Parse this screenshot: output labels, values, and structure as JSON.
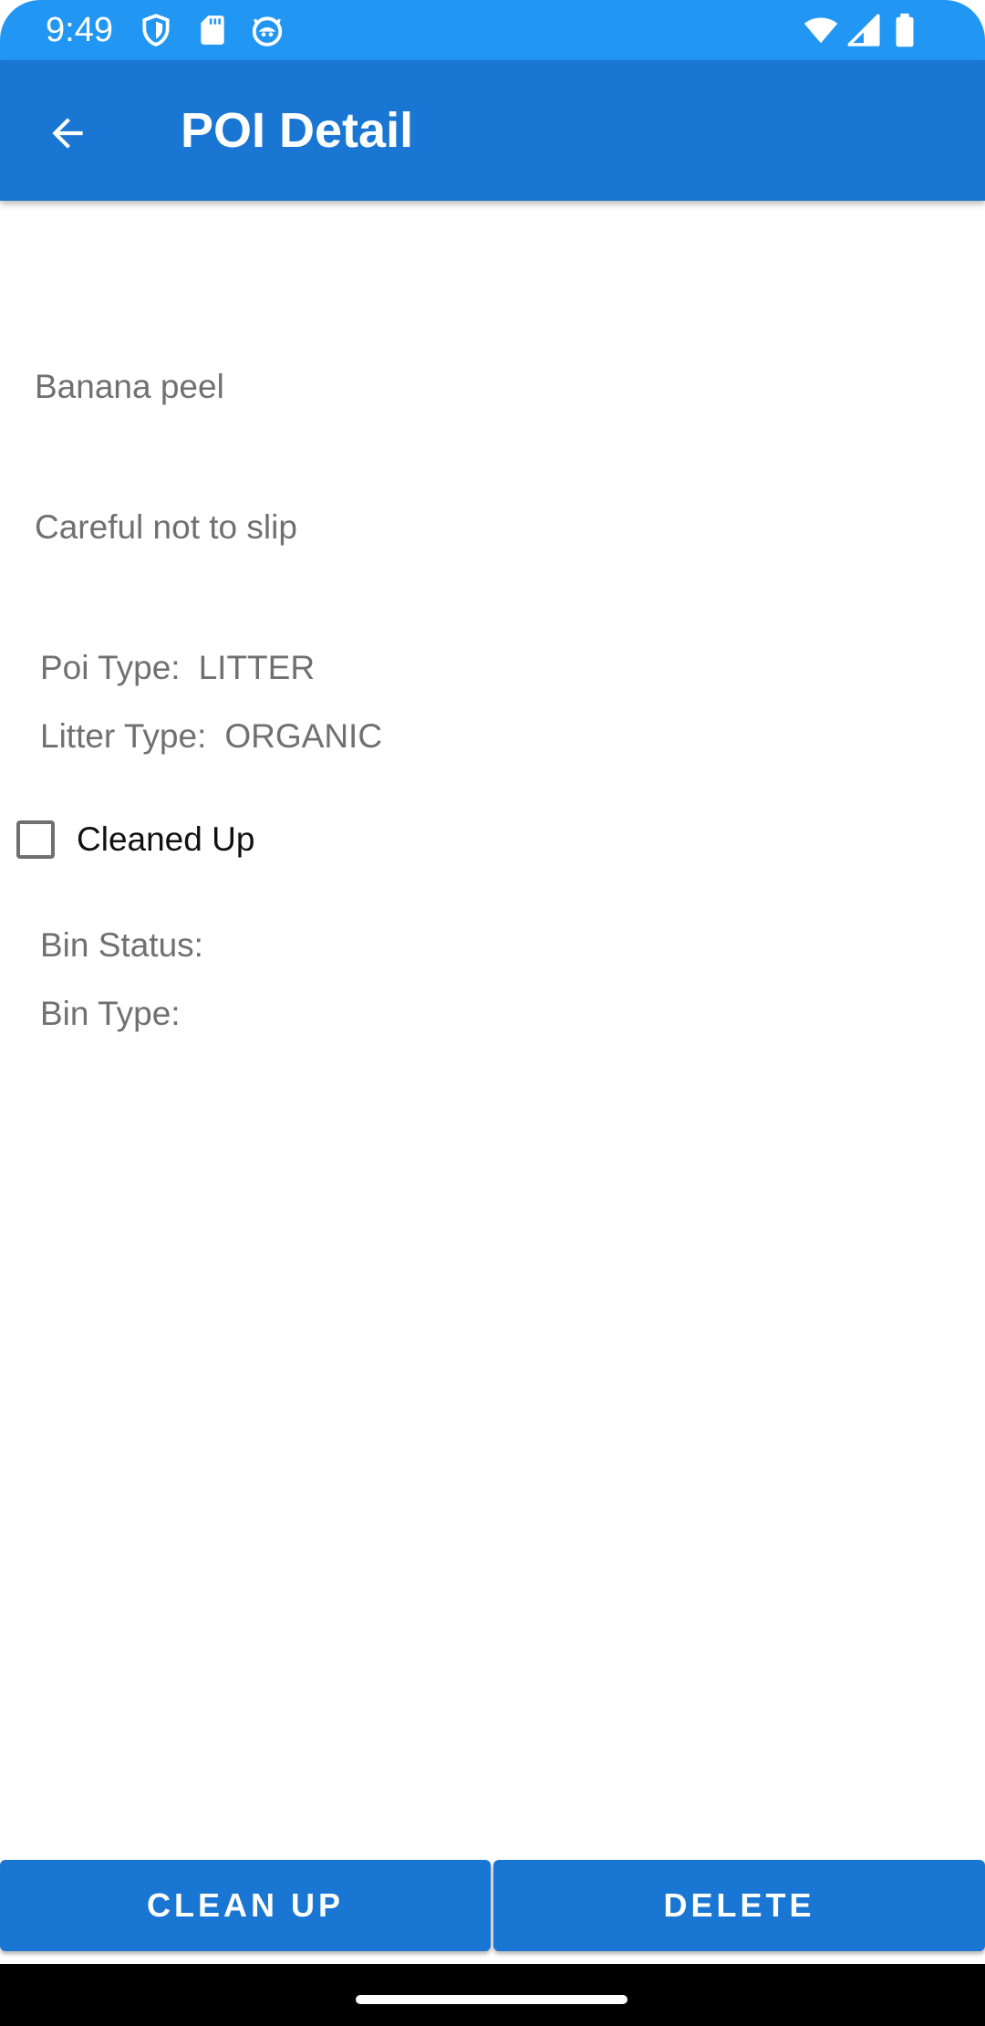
{
  "status_bar": {
    "time": "9:49",
    "left_icons": [
      "shield-icon",
      "sd-card-icon",
      "robot-face-icon"
    ],
    "right_icons": [
      "wifi-icon",
      "cell-signal-icon",
      "battery-icon"
    ],
    "color": "#2196f3"
  },
  "app_bar": {
    "title": "POI Detail",
    "back_icon": "arrow-left-icon",
    "color": "#1976d2"
  },
  "poi": {
    "name": "Banana peel",
    "description": "Careful not to slip",
    "poi_type_label": "Poi Type:",
    "poi_type_value": "LITTER",
    "litter_type_label": "Litter Type:",
    "litter_type_value": "ORGANIC",
    "cleaned_up_label": "Cleaned Up",
    "cleaned_up_checked": false,
    "bin_status_label": "Bin Status:",
    "bin_status_value": "",
    "bin_type_label": "Bin Type:",
    "bin_type_value": ""
  },
  "actions": {
    "clean_up_label": "CLEAN UP",
    "delete_label": "DELETE",
    "button_color": "#1976d2"
  }
}
